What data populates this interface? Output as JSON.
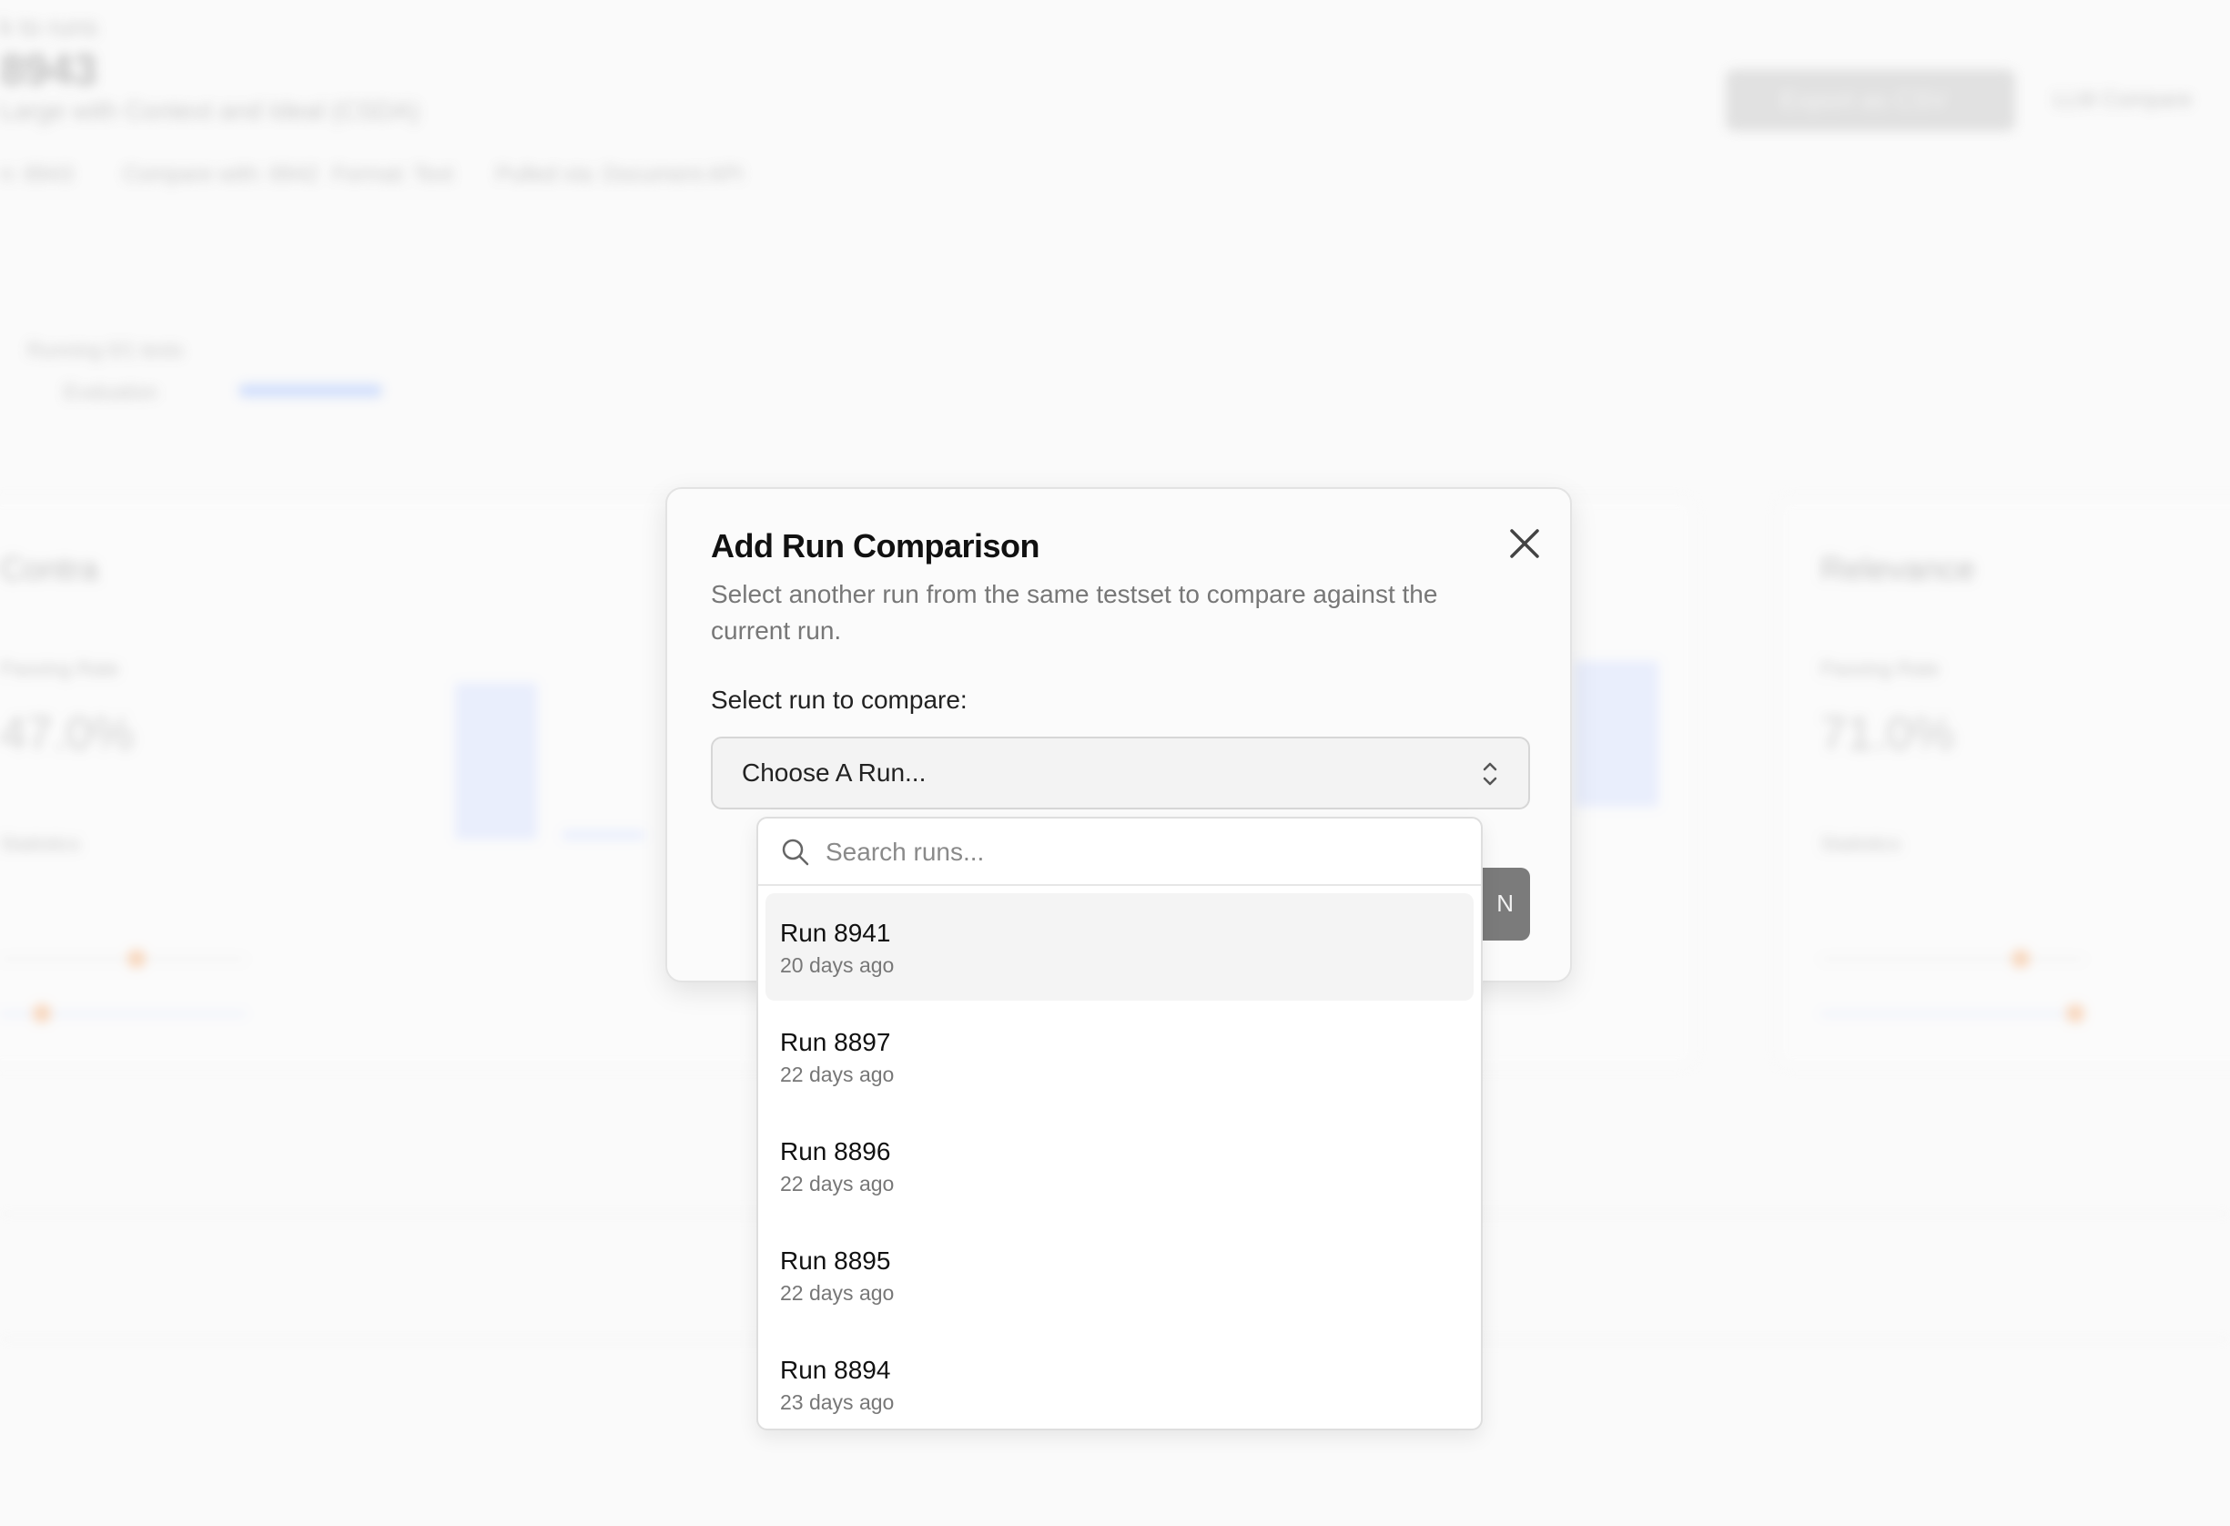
{
  "background": {
    "back_link": "k to runs",
    "run_title": "8943",
    "run_subtitle": "Large with Context and Ideal (CSDA)",
    "meta": [
      "n: 8943",
      "Compare with: 8942",
      "Format: Text",
      "Pulled via: Document API"
    ],
    "export_button": "Export as CSV",
    "header_right": "LLM   Compare",
    "running_label": "Running 0/1 tests",
    "progress_label": "Evaluation",
    "card_left_title": "Contra",
    "card_right_title": "Relevance",
    "passing_rate_label": "Passing Rate",
    "left_rate": "47.0%",
    "right_rate": "71.0%",
    "statistics_label": "Statistics"
  },
  "modal": {
    "title": "Add Run Comparison",
    "description": "Select another run from the same testset to compare against the current run.",
    "select_label": "Select run to compare:",
    "select_placeholder": "Choose A Run...",
    "compare_button_label": "N"
  },
  "dropdown": {
    "search_placeholder": "Search runs...",
    "runs": [
      {
        "name": "Run 8941",
        "age": "20 days ago",
        "highlighted": true
      },
      {
        "name": "Run 8897",
        "age": "22 days ago",
        "highlighted": false
      },
      {
        "name": "Run 8896",
        "age": "22 days ago",
        "highlighted": false
      },
      {
        "name": "Run 8895",
        "age": "22 days ago",
        "highlighted": false
      },
      {
        "name": "Run 8894",
        "age": "23 days ago",
        "highlighted": false
      }
    ]
  },
  "colors": {
    "accent_bar": "#d8e2ff",
    "progress": "#a9c4ff",
    "highlight_row": "#f4f4f4",
    "compare_button": "#7b7b7b"
  },
  "icons": {
    "close": "close-icon",
    "select_chevron": "chevron-updown-icon",
    "search": "search-icon"
  }
}
